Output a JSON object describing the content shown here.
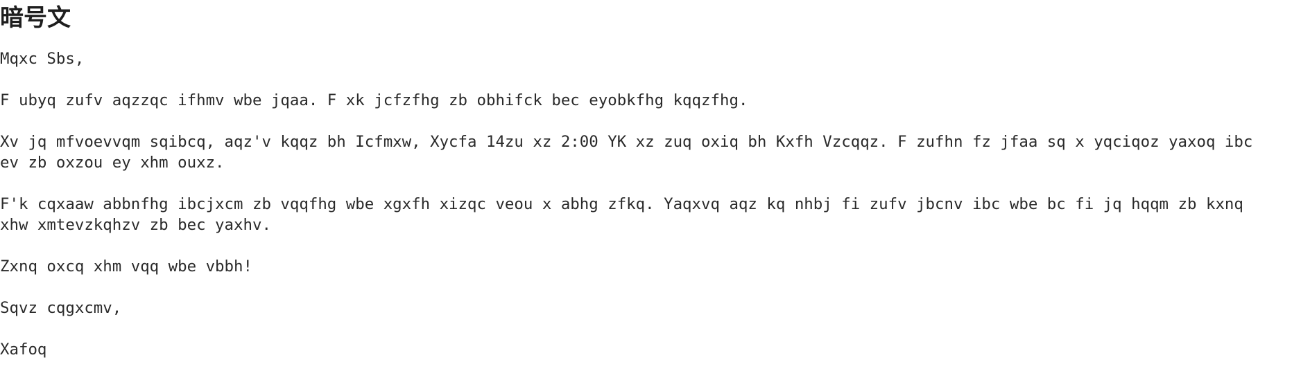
{
  "document": {
    "title": "暗号文",
    "greeting": "Mqxc Sbs,",
    "paragraph1": "F ubyq zufv aqzzqc ifhmv wbe jqaa. F xk jcfzfhg zb obhifck bec eyobkfhg kqqzfhg.",
    "paragraph2": {
      "line1": "Xv jq mfvoevvqm sqibcq, aqz'v kqqz bh Icfmxw, Xycfa 14zu xz 2:00 YK xz zuq oxiq bh Kxfh Vzcqqz. F zufhn fz jfaa sq x yqciqoz yaxoq ibc",
      "line2": "ev zb oxzou ey xhm ouxz."
    },
    "paragraph3": {
      "line1": "F'k cqxaaw abbnfhg ibcjxcm zb vqqfhg wbe xgxfh xizqc veou x abhg zfkq. Yaqxvq aqz kq nhbj fi zufv jbcnv ibc wbe bc fi jq hqqm zb kxnq",
      "line2": "xhw xmtevzkqhzv zb bec yaxhv."
    },
    "paragraph4": "Zxnq oxcq xhm vqq wbe vbbh!",
    "closing": "Sqvz cqgxcmv,",
    "signature": "Xafoq"
  }
}
